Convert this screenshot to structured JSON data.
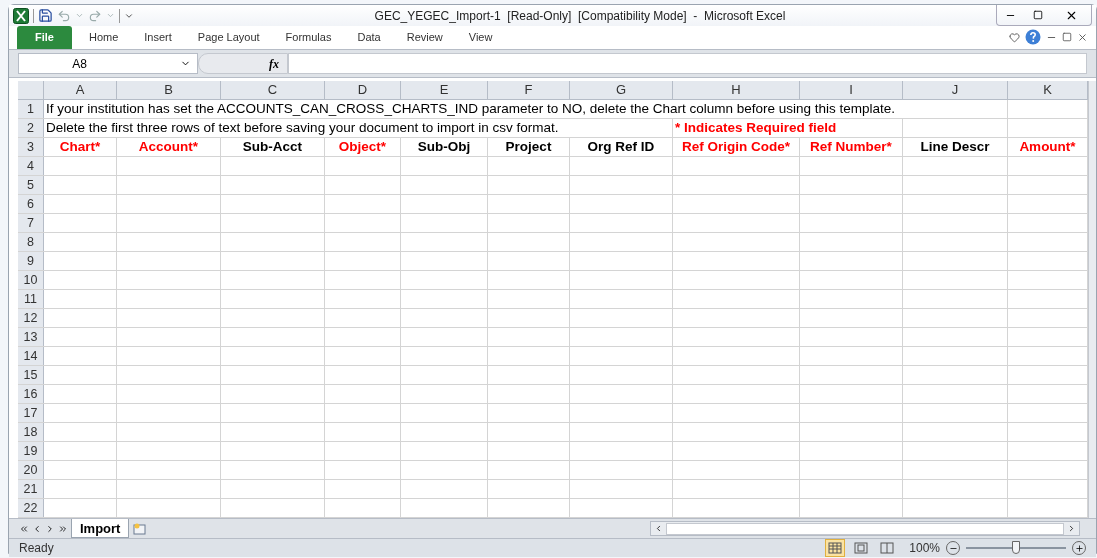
{
  "window": {
    "title": "GEC_YEGEC_Import-1  [Read-Only]  [Compatibility Mode]  -  Microsoft Excel"
  },
  "ribbon_tabs": [
    {
      "label": "File",
      "selected": true
    },
    {
      "label": "Home",
      "selected": false
    },
    {
      "label": "Insert",
      "selected": false
    },
    {
      "label": "Page Layout",
      "selected": false
    },
    {
      "label": "Formulas",
      "selected": false
    },
    {
      "label": "Data",
      "selected": false
    },
    {
      "label": "Review",
      "selected": false
    },
    {
      "label": "View",
      "selected": false
    }
  ],
  "formula_bar": {
    "name_box": "A8",
    "function_label": "fx"
  },
  "columns": [
    "A",
    "B",
    "C",
    "D",
    "E",
    "F",
    "G",
    "H",
    "I",
    "J",
    "K"
  ],
  "note_rows": [
    {
      "number": "1",
      "cells": [
        {
          "text": "If your institution has set the ACCOUNTS_CAN_CROSS_CHARTS_IND parameter to NO, delete the Chart column before using this template.",
          "color": "#000000"
        }
      ]
    },
    {
      "number": "2",
      "cells": [
        {
          "text": "Delete the first three rows of text before saving your document to import in csv format.",
          "color": "#000000"
        },
        {
          "text": "* Indicates Required field",
          "color": "#ff0000"
        }
      ]
    }
  ],
  "header_row": {
    "number": "3",
    "headers": [
      {
        "text": "Chart*",
        "required": true
      },
      {
        "text": "Account*",
        "required": true
      },
      {
        "text": "Sub-Acct",
        "required": false
      },
      {
        "text": "Object*",
        "required": true
      },
      {
        "text": "Sub-Obj",
        "required": false
      },
      {
        "text": "Project",
        "required": false
      },
      {
        "text": "Org Ref ID",
        "required": false
      },
      {
        "text": "Ref Origin Code*",
        "required": true
      },
      {
        "text": "Ref Number*",
        "required": true
      },
      {
        "text": "Line Descr",
        "required": false
      },
      {
        "text": "Amount*",
        "required": true
      }
    ]
  },
  "empty_rows": [
    "4",
    "5",
    "6",
    "7",
    "8",
    "9",
    "10",
    "11",
    "12",
    "13",
    "14",
    "15",
    "16",
    "17",
    "18",
    "19",
    "20",
    "21",
    "22"
  ],
  "sheet_tabs": [
    {
      "label": "Import",
      "selected": true
    }
  ],
  "status_bar": {
    "status": "Ready",
    "views": [
      {
        "kind": "normal",
        "selected": true
      },
      {
        "kind": "page-layout",
        "selected": false
      },
      {
        "kind": "page-break",
        "selected": false
      }
    ],
    "zoom": "100%",
    "zoom_level": {
      "level": 0.5
    }
  }
}
